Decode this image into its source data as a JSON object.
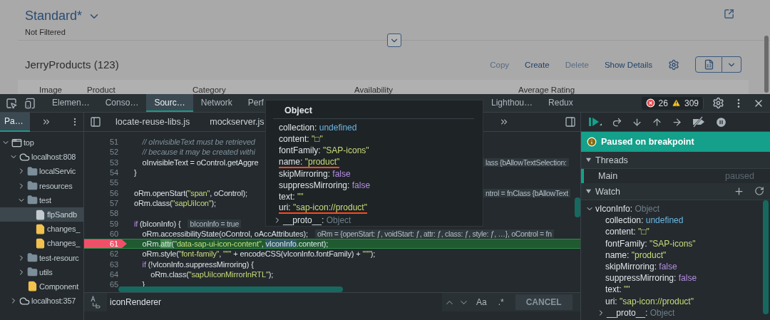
{
  "page": {
    "view_title": "Standard*",
    "filter_status": "Not Filtered",
    "table_title": "JerryProducts (123)",
    "actions": [
      {
        "label": "Copy",
        "disabled": true
      },
      {
        "label": "Create",
        "disabled": false
      },
      {
        "label": "Delete",
        "disabled": true
      },
      {
        "label": "Show Details",
        "disabled": false
      }
    ],
    "columns": [
      "Image",
      "Product",
      "Category",
      "Availability",
      "Average Rating"
    ]
  },
  "devtools": {
    "tabs": [
      {
        "label": "Elemen…",
        "selected": false
      },
      {
        "label": "Conso…",
        "selected": false
      },
      {
        "label": "Sourc…",
        "selected": true
      },
      {
        "label": "Network",
        "selected": false
      },
      {
        "label": "Perf",
        "selected": false
      },
      {
        "label": "Lighthou…",
        "selected": false
      },
      {
        "label": "Redux",
        "selected": false
      }
    ],
    "errors": "26",
    "warnings": "309",
    "navigator": {
      "tabs": [
        {
          "label": "Pa…",
          "selected": true
        }
      ],
      "tree": [
        {
          "label": "top",
          "kind": "frame",
          "expanded": true,
          "selected": false,
          "children": [
            {
              "label": "localhost:808",
              "kind": "origin",
              "expanded": true,
              "selected": false,
              "children": [
                {
                  "label": "localServic",
                  "kind": "folder",
                  "expanded": false,
                  "selected": false
                },
                {
                  "label": "resources",
                  "kind": "folder",
                  "expanded": false,
                  "selected": false
                },
                {
                  "label": "test",
                  "kind": "folder",
                  "expanded": true,
                  "selected": false,
                  "children": [
                    {
                      "label": "flpSandb",
                      "kind": "page",
                      "selected": true
                    },
                    {
                      "label": "changes_",
                      "kind": "script",
                      "selected": false
                    },
                    {
                      "label": "changes_",
                      "kind": "script",
                      "selected": false
                    }
                  ]
                },
                {
                  "label": "test-resourc",
                  "kind": "folder",
                  "expanded": false,
                  "selected": false
                },
                {
                  "label": "utils",
                  "kind": "folder",
                  "expanded": false,
                  "selected": false
                },
                {
                  "label": "Component",
                  "kind": "script",
                  "selected": false
                }
              ]
            },
            {
              "label": "localhost:357",
              "kind": "origin",
              "expanded": false,
              "selected": false
            }
          ]
        }
      ]
    },
    "files": [
      {
        "label": "locate-reuse-libs.js",
        "selected": false
      },
      {
        "label": "mockserver.js",
        "selected": false
      }
    ],
    "code": [
      {
        "number": "51",
        "breakpoint": false,
        "current": false,
        "segments": [
          {
            "kind": "comment",
            "text": "    // oInvisibleText must be retrieved"
          }
        ]
      },
      {
        "number": "52",
        "breakpoint": false,
        "current": false,
        "segments": [
          {
            "kind": "comment",
            "text": "    // because it may be created withi"
          }
        ]
      },
      {
        "number": "53",
        "breakpoint": false,
        "current": false,
        "segments": [
          {
            "kind": "plain",
            "text": "    oInvisibleText = oControl.getAggre"
          }
        ],
        "tail": [
          {
            "kind": "inline",
            "text": "lass {bAllowTextSelection:"
          }
        ]
      },
      {
        "number": "54",
        "breakpoint": false,
        "current": false,
        "segments": [
          {
            "kind": "plain",
            "text": "}"
          }
        ]
      },
      {
        "number": "55",
        "breakpoint": false,
        "current": false
      },
      {
        "number": "56",
        "breakpoint": false,
        "current": false,
        "segments": [
          {
            "kind": "plain",
            "text": "oRm.openStart("
          },
          {
            "kind": "string",
            "text": "\"span\""
          },
          {
            "kind": "plain",
            "text": ", oControl);"
          }
        ],
        "tail": [
          {
            "kind": "inline",
            "text": "ntrol = fnClass {bAllowText"
          }
        ]
      },
      {
        "number": "57",
        "breakpoint": false,
        "current": false,
        "segments": [
          {
            "kind": "plain",
            "text": "oRm.class("
          },
          {
            "kind": "string",
            "text": "\"sapUiIcon\""
          },
          {
            "kind": "plain",
            "text": ");"
          }
        ]
      },
      {
        "number": "58",
        "breakpoint": false,
        "current": false
      },
      {
        "number": "59",
        "breakpoint": false,
        "current": false,
        "segments": [
          {
            "kind": "keyword",
            "text": "if"
          },
          {
            "kind": "plain",
            "text": " (bIconInfo) {"
          },
          {
            "kind": "inline",
            "text": "bIconInfo = true"
          }
        ]
      },
      {
        "number": "60",
        "breakpoint": false,
        "current": false,
        "segments": [
          {
            "kind": "plain",
            "text": "    oRm.accessibilityState(oControl, oAccAttributes);"
          },
          {
            "kind": "inline",
            "text": "oRm = {openStart: ƒ, voidStart: ƒ, attr: ƒ, class: ƒ, style: ƒ, …}, oControl = fn"
          }
        ]
      },
      {
        "number": "61",
        "breakpoint": true,
        "current": true,
        "segments": [
          {
            "kind": "plain",
            "text": "    oRm."
          },
          {
            "kind": "step",
            "text": "attr"
          },
          {
            "kind": "plain",
            "text": "("
          },
          {
            "kind": "string",
            "text": "\"data-sap-ui-icon-content\""
          },
          {
            "kind": "plain",
            "text": ", "
          },
          {
            "kind": "hover",
            "text": "vIconInfo"
          },
          {
            "kind": "plain",
            "text": ".content);"
          }
        ]
      },
      {
        "number": "62",
        "breakpoint": false,
        "current": false,
        "segments": [
          {
            "kind": "plain",
            "text": "    oRm.style("
          },
          {
            "kind": "string",
            "text": "\"font-family\""
          },
          {
            "kind": "plain",
            "text": ", "
          },
          {
            "kind": "string",
            "text": "\"\"\""
          },
          {
            "kind": "plain",
            "text": " + encodeCSS(vIconInfo.fontFamily) + "
          },
          {
            "kind": "string",
            "text": "\"\"\""
          },
          {
            "kind": "plain",
            "text": ");"
          }
        ]
      },
      {
        "number": "63",
        "breakpoint": false,
        "current": false,
        "segments": [
          {
            "kind": "keyword",
            "text": "    if"
          },
          {
            "kind": "plain",
            "text": " (!vIconInfo.suppressMirroring) {"
          }
        ]
      },
      {
        "number": "64",
        "breakpoint": false,
        "current": false,
        "segments": [
          {
            "kind": "plain",
            "text": "        oRm.class("
          },
          {
            "kind": "string",
            "text": "\"sapUiIconMirrorInRTL\""
          },
          {
            "kind": "plain",
            "text": ");"
          }
        ]
      },
      {
        "number": "65",
        "breakpoint": false,
        "current": false,
        "segments": [
          {
            "kind": "plain",
            "text": "    }"
          }
        ]
      }
    ],
    "search": {
      "value": "iconRenderer",
      "case_label": "Aa",
      "regex_label": ".*",
      "cancel": "CANCEL"
    },
    "debugger": {
      "status": "Paused on breakpoint",
      "threads": {
        "title": "Threads",
        "expanded": true,
        "items": [
          {
            "name": "Main",
            "state": "paused",
            "selected": true
          }
        ]
      },
      "watch": {
        "title": "Watch",
        "expanded": true,
        "items": [
          {
            "name": "vIconInfo:",
            "summary": "Object",
            "expanded": true,
            "properties": [
              {
                "key": "collection:",
                "value": "undefined",
                "kind": "undefined"
              },
              {
                "key": "content:",
                "value": "\"□\"",
                "kind": "string"
              },
              {
                "key": "fontFamily:",
                "value": "\"SAP-icons\"",
                "kind": "string"
              },
              {
                "key": "name:",
                "value": "\"product\"",
                "kind": "string"
              },
              {
                "key": "skipMirroring:",
                "value": "false",
                "kind": "boolean"
              },
              {
                "key": "suppressMirroring:",
                "value": "false",
                "kind": "boolean"
              },
              {
                "key": "text:",
                "value": "\"\"",
                "kind": "string"
              },
              {
                "key": "uri:",
                "value": "\"sap-icon://product\"",
                "kind": "string"
              }
            ],
            "proto": {
              "key": "__proto__:",
              "value": "Object",
              "expanded": false
            }
          }
        ]
      }
    },
    "popover": {
      "title": "Object",
      "properties": [
        {
          "key": "collection:",
          "value": "undefined",
          "kind": "undefined",
          "underlined": false
        },
        {
          "key": "content:",
          "value": "\"□\"",
          "kind": "string",
          "underlined": false
        },
        {
          "key": "fontFamily:",
          "value": "\"SAP-icons\"",
          "kind": "string",
          "underlined": false
        },
        {
          "key": "name:",
          "value": "\"product\"",
          "kind": "string",
          "underlined": true
        },
        {
          "key": "skipMirroring:",
          "value": "false",
          "kind": "boolean",
          "underlined": false
        },
        {
          "key": "suppressMirroring:",
          "value": "false",
          "kind": "boolean",
          "underlined": false
        },
        {
          "key": "text:",
          "value": "\"\"",
          "kind": "string",
          "underlined": false
        },
        {
          "key": "uri:",
          "value": "\"sap-icon://product\"",
          "kind": "string",
          "underlined": true
        }
      ],
      "proto": {
        "key": "__proto__:",
        "value": "Object",
        "expanded": false
      }
    }
  }
}
